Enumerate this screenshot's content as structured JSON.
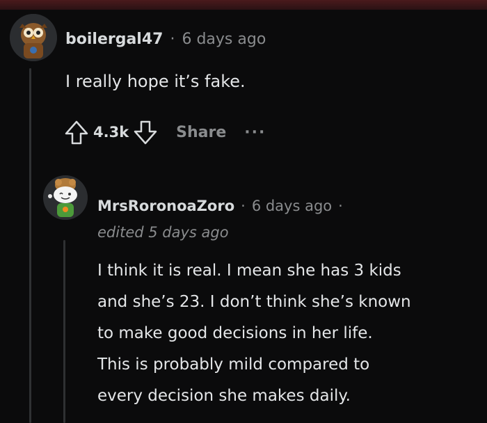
{
  "comment1": {
    "username": "boilergal47",
    "separator": "·",
    "time": "6 days ago",
    "body": "I really hope it’s fake.",
    "score": "4.3k",
    "share_label": "Share",
    "more_label": "···",
    "avatar_icon": "owl-avatar-icon"
  },
  "comment2": {
    "username": "MrsRoronoaZoro",
    "separator": "·",
    "time": "6 days ago",
    "separator2": "·",
    "edited": "edited 5 days ago",
    "avatar_icon": "snoo-avatar-icon",
    "body_lines": [
      "I think it is real. I mean she has 3 kids",
      "and she’s 23. I don’t think she’s known",
      "to make good decisions in her life.",
      "This is probably mild compared to",
      "every decision she makes daily."
    ]
  },
  "colors": {
    "background": "#0b0b0c",
    "text": "#e4e6e8",
    "muted": "#8a8c8e",
    "thread_line": "#2f3133",
    "top_bar": "#3a1618"
  }
}
